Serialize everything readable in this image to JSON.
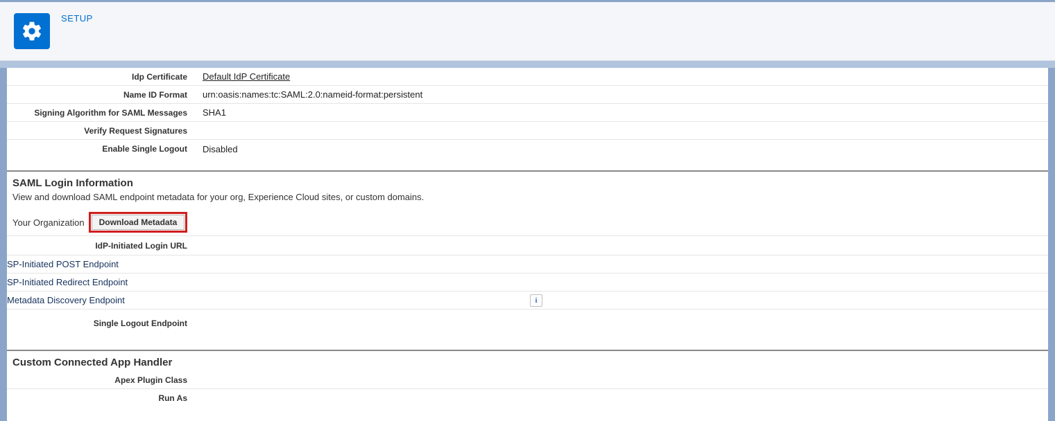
{
  "header": {
    "title": "SETUP"
  },
  "idp_details": {
    "idp_certificate_label": "Idp Certificate",
    "idp_certificate_value": "Default IdP Certificate",
    "name_id_format_label": "Name ID Format",
    "name_id_format_value": "urn:oasis:names:tc:SAML:2.0:nameid-format:persistent",
    "signing_algorithm_label": "Signing Algorithm for SAML Messages",
    "signing_algorithm_value": "SHA1",
    "verify_request_label": "Verify Request Signatures",
    "verify_request_value": "",
    "enable_slo_label": "Enable Single Logout",
    "enable_slo_value": "Disabled"
  },
  "saml_login_section": {
    "title": "SAML Login Information",
    "subtitle": "View and download SAML endpoint metadata for your org, Experience Cloud sites, or custom domains.",
    "org_label": "Your Organization",
    "download_button": "Download Metadata",
    "idp_login_url_label": "IdP-Initiated Login URL",
    "sp_post_endpoint_label": "SP-Initiated POST Endpoint",
    "sp_redirect_endpoint_label": "SP-Initiated Redirect Endpoint",
    "metadata_discovery_label": "Metadata Discovery Endpoint",
    "slo_endpoint_label": "Single Logout Endpoint"
  },
  "custom_handler_section": {
    "title": "Custom Connected App Handler",
    "apex_plugin_label": "Apex Plugin Class",
    "run_as_label": "Run As"
  },
  "info_icon_text": "i"
}
